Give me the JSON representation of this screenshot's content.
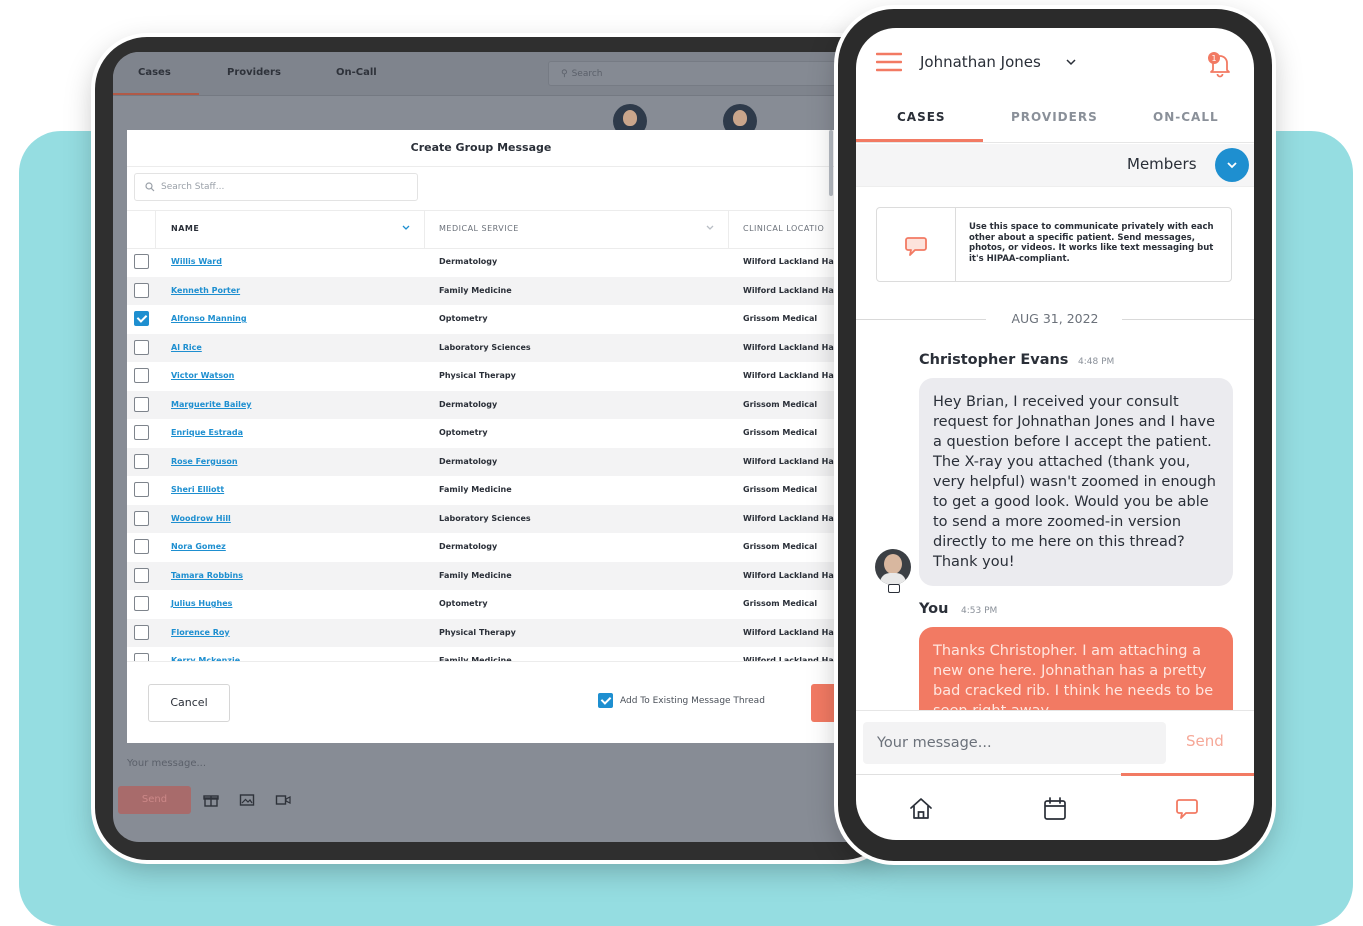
{
  "colors": {
    "accent": "#f27a63",
    "link": "#1e8fd0",
    "teal_bg": "#95dde1"
  },
  "tablet": {
    "nav": {
      "tabs": [
        "Cases",
        "Providers",
        "On-Call"
      ],
      "search_placeholder": "Search"
    },
    "dialog": {
      "title": "Create Group Message",
      "search_placeholder": "Search Staff...",
      "columns": {
        "name": "NAME",
        "service": "MEDICAL SERVICE",
        "location": "CLINICAL LOCATIO"
      },
      "rows": [
        {
          "name": "Willis Ward",
          "service": "Dermatology",
          "location": "Wilford Lackland Ha",
          "checked": false
        },
        {
          "name": "Kenneth Porter",
          "service": "Family Medicine",
          "location": "Wilford Lackland Ha",
          "checked": false
        },
        {
          "name": "Alfonso Manning",
          "service": "Optometry",
          "location": "Grissom Medical",
          "checked": true
        },
        {
          "name": "Al Rice",
          "service": "Laboratory Sciences",
          "location": "Wilford Lackland Ha",
          "checked": false
        },
        {
          "name": "Victor Watson",
          "service": "Physical Therapy",
          "location": "Wilford Lackland Ha",
          "checked": false
        },
        {
          "name": "Marguerite Bailey",
          "service": "Dermatology",
          "location": "Grissom Medical",
          "checked": false
        },
        {
          "name": "Enrique Estrada",
          "service": "Optometry",
          "location": "Grissom Medical",
          "checked": false
        },
        {
          "name": "Rose Ferguson",
          "service": "Dermatology",
          "location": "Wilford Lackland Ha",
          "checked": false
        },
        {
          "name": "Sheri Elliott",
          "service": "Family Medicine",
          "location": "Grissom Medical",
          "checked": false
        },
        {
          "name": "Woodrow Hill",
          "service": "Laboratory Sciences",
          "location": "Wilford Lackland Ha",
          "checked": false
        },
        {
          "name": "Nora Gomez",
          "service": "Dermatology",
          "location": "Grissom Medical",
          "checked": false
        },
        {
          "name": "Tamara Robbins",
          "service": "Family Medicine",
          "location": "Wilford Lackland Ha",
          "checked": false
        },
        {
          "name": "Julius Hughes",
          "service": "Optometry",
          "location": "Grissom Medical",
          "checked": false
        },
        {
          "name": "Florence Roy",
          "service": "Physical Therapy",
          "location": "Wilford Lackland Ha",
          "checked": false
        },
        {
          "name": "Kerry Mckenzie",
          "service": "Family Medicine",
          "location": "Wilford Lackland Ha",
          "checked": false
        }
      ],
      "cancel_label": "Cancel",
      "add_existing_label": "Add To Existing Message Thread",
      "add_existing_checked": true
    },
    "message_placeholder": "Your message...",
    "send_label": "Send"
  },
  "phone": {
    "user_name": "Johnathan Jones",
    "notification_count": "1",
    "tabs": [
      "CASES",
      "PROVIDERS",
      "ON-CALL"
    ],
    "active_tab": "CASES",
    "members_label": "Members",
    "info_text": "Use this space to communicate privately with each other about a specific patient. Send messages, photos, or videos. It works like text messaging but it's HIPAA-compliant.",
    "date_divider": "AUG 31, 2022",
    "messages": [
      {
        "sender": "Christopher Evans",
        "time": "4:48 PM",
        "text": "Hey Brian, I received your consult request for Johnathan Jones and I have a question before I accept the patient. The X-ray you attached (thank you, very helpful) wasn't zoomed in enough to get a good look. Would you be able to send a more zoomed-in version directly to me here on this thread? Thank you!"
      },
      {
        "sender": "You",
        "time": "4:53 PM",
        "text": "Thanks Christopher. I am attaching a new one here. Johnathan has a pretty bad cracked rib. I think he needs to be seen right away."
      }
    ],
    "message_placeholder": "Your message...",
    "send_label": "Send",
    "bottom_nav": [
      "home-icon",
      "calendar-icon",
      "chat-icon"
    ]
  }
}
